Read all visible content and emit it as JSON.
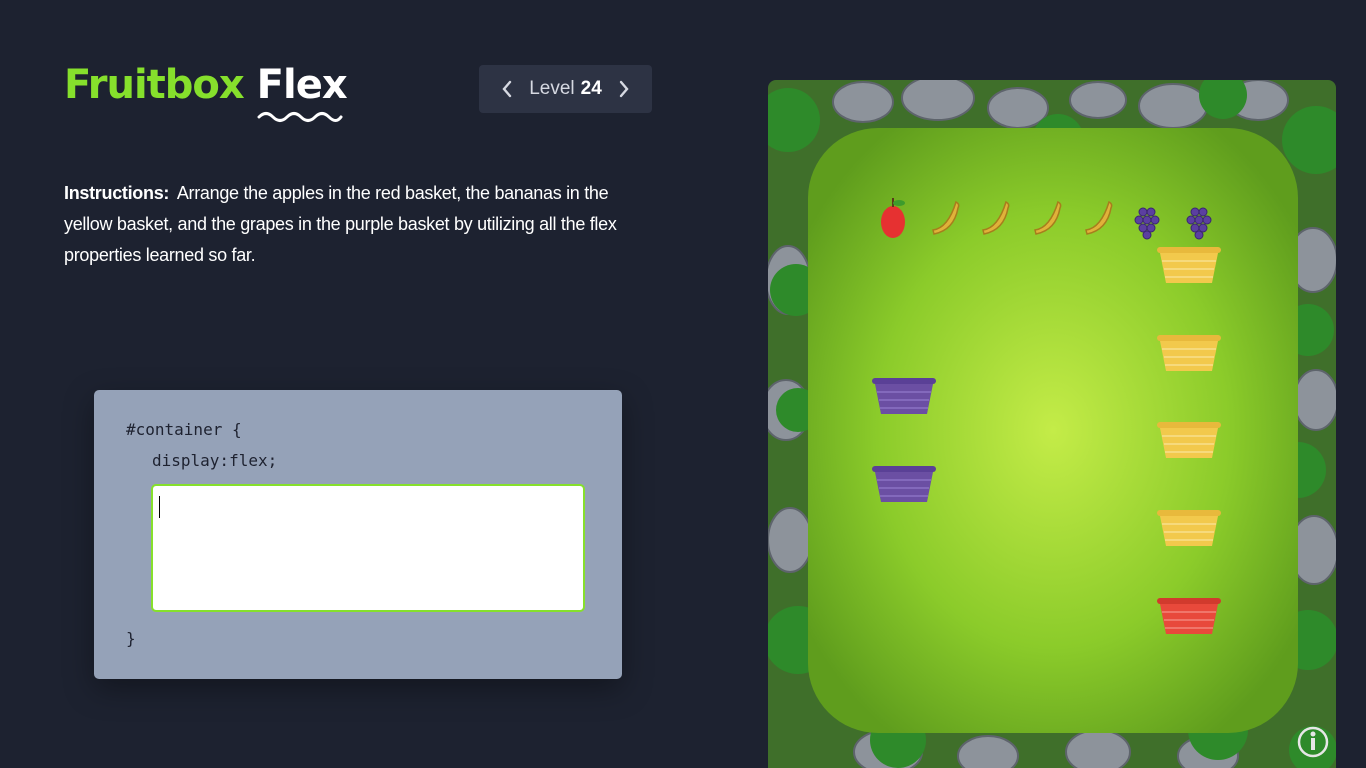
{
  "title": {
    "part1": "Fruitbox",
    "part2": "Flex"
  },
  "level": {
    "label": "Level",
    "number": "24",
    "prev_icon": "chevron-left-icon",
    "next_icon": "chevron-right-icon"
  },
  "instructions": {
    "label": "Instructions:",
    "text": "Arrange the apples in the red basket, the bananas in the yellow basket, and the grapes in the purple basket by utilizing all the flex properties learned so far."
  },
  "editor": {
    "line1": "#container {",
    "line2": "display:flex;",
    "closing": "}",
    "input_value": ""
  },
  "board": {
    "fruits": [
      "apple",
      "banana",
      "banana",
      "banana",
      "banana",
      "grapes",
      "grapes"
    ],
    "baskets": [
      {
        "color": "yellow"
      },
      {
        "color": "yellow"
      },
      {
        "color": "purple"
      },
      {
        "color": "yellow"
      },
      {
        "color": "purple"
      },
      {
        "color": "yellow"
      },
      {
        "color": "red"
      }
    ],
    "info_icon": "info-icon"
  },
  "colors": {
    "background": "#1d2230",
    "accent": "#86e02c",
    "editor_bg": "#95a2b8",
    "yellow_basket": "#f2c94c",
    "purple_basket": "#6b4fa3",
    "red_basket": "#e8493b"
  }
}
